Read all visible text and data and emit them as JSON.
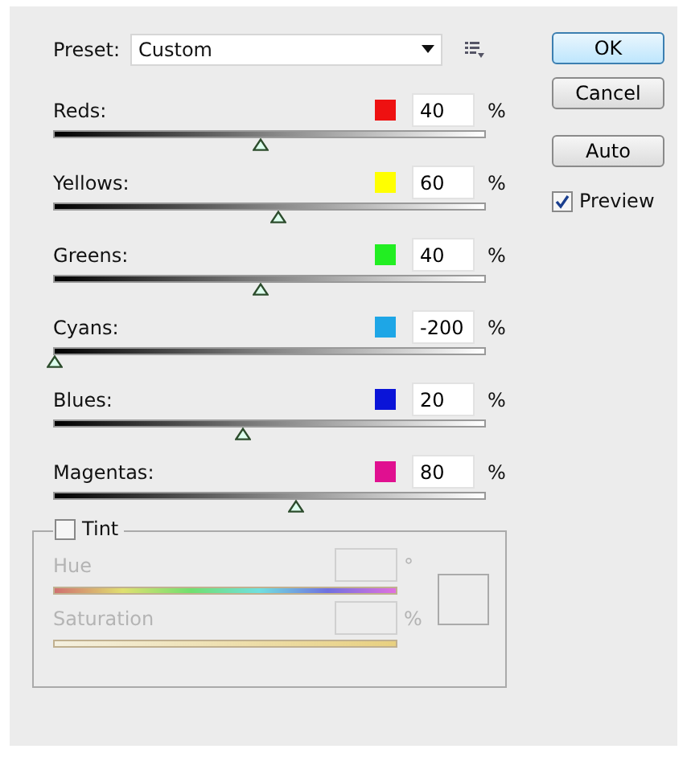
{
  "preset": {
    "label": "Preset:",
    "value": "Custom"
  },
  "channels": [
    {
      "name": "Reds:",
      "color": "#ee1111",
      "value": "40",
      "unit": "%",
      "level": 0.48
    },
    {
      "name": "Yellows:",
      "color": "#ffff00",
      "value": "60",
      "unit": "%",
      "level": 0.52
    },
    {
      "name": "Greens:",
      "color": "#22ee22",
      "value": "40",
      "unit": "%",
      "level": 0.48
    },
    {
      "name": "Cyans:",
      "color": "#1ea6e6",
      "value": "-200",
      "unit": "%",
      "level": 0
    },
    {
      "name": "Blues:",
      "color": "#0a14d8",
      "value": "20",
      "unit": "%",
      "level": 0.44
    },
    {
      "name": "Magentas:",
      "color": "#e01090",
      "value": "80",
      "unit": "%",
      "level": 0.56
    }
  ],
  "buttons": [
    {
      "label": "OK",
      "default": true
    },
    {
      "label": "Cancel",
      "default": false
    },
    {
      "label": "Auto",
      "default": false
    }
  ],
  "preview": {
    "label": "Preview",
    "checked": true
  },
  "tint": {
    "label": "Tint",
    "checked": false,
    "hue": {
      "label": "Hue",
      "unit": "°"
    },
    "saturation": {
      "label": "Saturation",
      "unit": "%"
    }
  }
}
